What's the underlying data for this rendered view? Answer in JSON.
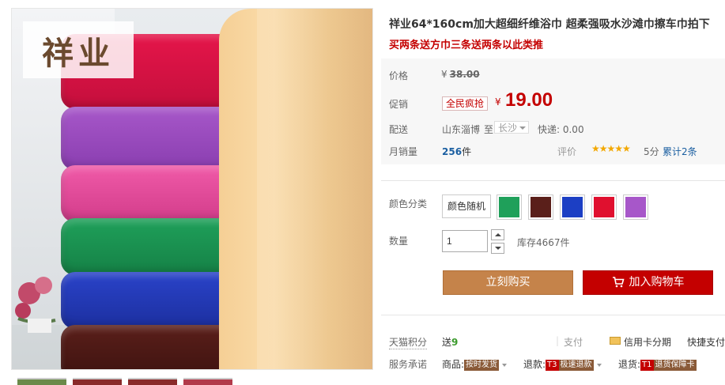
{
  "gallery": {
    "brand_logo_text": "祥业",
    "thumbnail_count": 4
  },
  "product": {
    "title": "祥业64*160cm加大超细纤维浴巾 超柔强吸水沙滩巾擦车巾拍下",
    "subtitle": "买两条送方巾三条送两条以此类推"
  },
  "price": {
    "label": "价格",
    "currency": "¥",
    "original": "38.00"
  },
  "promo": {
    "label": "促销",
    "badge": "全民疯抢",
    "currency": "¥",
    "price": "19.00"
  },
  "shipping": {
    "label": "配送",
    "from": "山东淄博",
    "to_word": "至",
    "city": "长沙",
    "fee_text": "快递: 0.00"
  },
  "sales": {
    "label": "月销量",
    "count": "256",
    "unit": "件"
  },
  "rating": {
    "label": "评价",
    "stars": "★★★★★",
    "score": "5分",
    "reviews": "累计2条"
  },
  "sku": {
    "label": "颜色分类",
    "random_option": "颜色随机",
    "swatches": [
      {
        "name": "green",
        "color": "#1fa05a"
      },
      {
        "name": "brown",
        "color": "#5a1f1a"
      },
      {
        "name": "blue",
        "color": "#1c3fc4"
      },
      {
        "name": "red",
        "color": "#e0102f"
      },
      {
        "name": "purple",
        "color": "#a757c9"
      }
    ]
  },
  "quantity": {
    "label": "数量",
    "value": "1",
    "stock": "库存4667件"
  },
  "actions": {
    "buy_now": "立刻购买",
    "add_to_cart": "加入购物车"
  },
  "points": {
    "label": "天猫积分",
    "prefix": "送",
    "value": "9"
  },
  "payment": {
    "label": "支付",
    "credit": "信用卡分期",
    "fast": "快捷支付"
  },
  "service": {
    "label": "服务承诺",
    "items": [
      {
        "prefix": "商品:",
        "tag": "按时发货"
      },
      {
        "prefix": "退款:",
        "code": "T3",
        "tag": "极速退款"
      },
      {
        "prefix": "退货:",
        "code": "T1",
        "tag": "退货保障卡"
      }
    ]
  }
}
